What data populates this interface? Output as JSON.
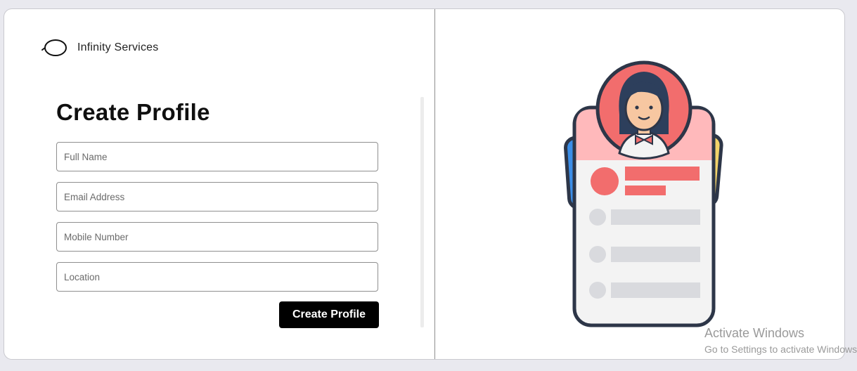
{
  "brand": {
    "name": "Infinity Services",
    "logo_icon": "infinity-logo-icon"
  },
  "form": {
    "title": "Create Profile",
    "fields": [
      {
        "placeholder": "Full Name",
        "value": ""
      },
      {
        "placeholder": "Email Address",
        "value": ""
      },
      {
        "placeholder": "Mobile Number",
        "value": ""
      },
      {
        "placeholder": "Location",
        "value": ""
      }
    ],
    "submit_label": "Create Profile"
  },
  "illustration": {
    "icon": "profile-card-illustration",
    "accent_colors": [
      "#f26d6d",
      "#ffb9bb",
      "#2d3648",
      "#f3f3f3",
      "#d9dade",
      "#3b8ee8",
      "#f3d36a"
    ]
  },
  "watermark": {
    "title": "Activate Windows",
    "subtitle": "Go to Settings to activate Windows."
  }
}
